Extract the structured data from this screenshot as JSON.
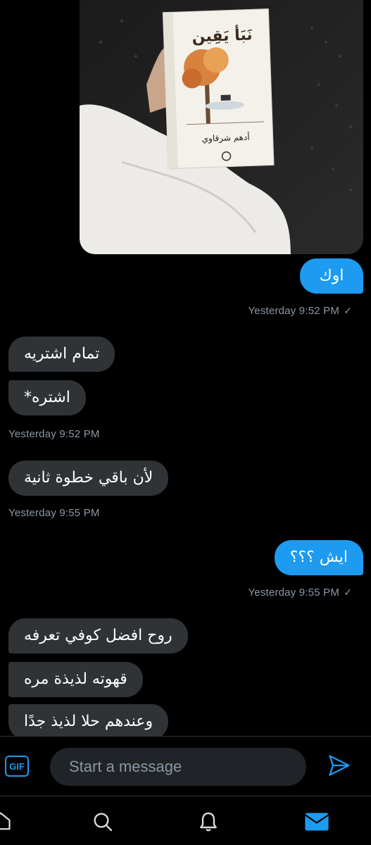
{
  "messages": [
    {
      "type": "image",
      "direction": "out",
      "image_text": {
        "title": "نَبَأ يَقِين",
        "author": "أدهم شرقاوي"
      }
    },
    {
      "type": "text",
      "direction": "out",
      "text": "اوك"
    },
    {
      "type": "timestamp",
      "direction": "out",
      "text": "Yesterday 9:52 PM",
      "status": "✓"
    },
    {
      "type": "text",
      "direction": "in",
      "text": "تمام اشتريه"
    },
    {
      "type": "text",
      "direction": "in",
      "text": "اشتره*"
    },
    {
      "type": "timestamp",
      "direction": "in",
      "text": "Yesterday 9:52 PM"
    },
    {
      "type": "text",
      "direction": "in",
      "text": "لأن باقي خطوة ثانية"
    },
    {
      "type": "timestamp",
      "direction": "in",
      "text": "Yesterday 9:55 PM"
    },
    {
      "type": "text",
      "direction": "out",
      "text": "ايش ؟؟؟"
    },
    {
      "type": "timestamp",
      "direction": "out",
      "text": "Yesterday 9:55 PM",
      "status": "✓"
    },
    {
      "type": "text",
      "direction": "in",
      "text": "روح افضل كوفي تعرفه"
    },
    {
      "type": "text",
      "direction": "in",
      "text": "قهوته لذيذة مره"
    },
    {
      "type": "text",
      "direction": "in",
      "text": "وعندهم حلا لذيذ جدًا"
    }
  ],
  "composer": {
    "gif_label": "GIF",
    "placeholder": "Start a message"
  },
  "tabbar": {
    "icons": [
      "home-icon",
      "search-icon",
      "notifications-icon",
      "messages-icon"
    ],
    "active": "messages-icon"
  },
  "colors": {
    "accent": "#1d9bf0",
    "incoming_bubble": "#2f3336",
    "timestamp": "#8b98a5",
    "background": "#000000"
  }
}
